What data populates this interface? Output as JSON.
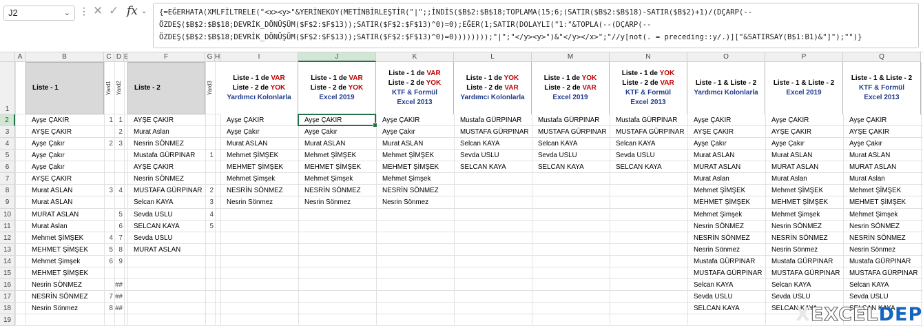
{
  "name_box": {
    "value": "J2",
    "chevron": "⌄"
  },
  "formula_bar": {
    "dots": "⋮",
    "cancel_icon": "✕",
    "enter_icon": "✓",
    "fx_label": "fx",
    "fx_chevron": "⌄",
    "formula": "{=EĞERHATA(XMLFİLTRELE(\"<x><y>\"&YERİNEKOY(METİNBİRLEŞTİR(\"|\";;İNDİS($B$2:$B$18;TOPLAMA(15;6;(SATIR($B$2:$B$18)-SATIR($B$2)+1)/(DÇARP(--ÖZDEŞ($B$2:$B$18;DEVRİK_DÖNÜŞÜM($F$2:$F$13));SATIR($F$2:$F$13)^0)=0);EĞER(1;SATIR(DOLAYLI(\"1:\"&TOPLA(--(DÇARP(--ÖZDEŞ($B$2:$B$18;DEVRİK_DÖNÜŞÜM($F$2:$F$13));SATIR($F$2:$F$13)^0)=0))))))));\"|\";\"</y><y>\")&\"</y></x>\";\"//y[not(. = preceding::y/.)][\"&SATIRSAY(B$1:B1)&\"]\");\"\")}"
  },
  "columns": [
    "A",
    "B",
    "C",
    "D",
    "E",
    "F",
    "G",
    "H",
    "I",
    "J",
    "K",
    "L",
    "M",
    "N",
    "O",
    "P",
    "Q"
  ],
  "rows": [
    "1",
    "2",
    "3",
    "4",
    "5",
    "6",
    "7",
    "8",
    "9",
    "10",
    "11",
    "12",
    "13",
    "14",
    "15",
    "16",
    "17",
    "18",
    "19"
  ],
  "headers": {
    "B": "Liste - 1",
    "C": "Yard1",
    "D": "Yard2",
    "F": "Liste - 2",
    "G": "Yard3",
    "I": [
      "Liste - 1 de ",
      "VAR",
      "Liste - 2 de ",
      "YOK",
      "Yardımcı Kolonlarla"
    ],
    "J": [
      "Liste - 1 de ",
      "VAR",
      "Liste - 2 de ",
      "YOK",
      "Excel 2019"
    ],
    "K": [
      "Liste - 1 de ",
      "VAR",
      "Liste - 2 de ",
      "YOK",
      "KTF & Formül",
      "Excel 2013"
    ],
    "L": [
      "Liste - 1 de ",
      "YOK",
      "Liste - 2 de ",
      "VAR",
      "Yardımcı Kolonlarla"
    ],
    "M": [
      "Liste - 1 de ",
      "YOK",
      "Liste - 2 de ",
      "VAR",
      "Excel 2019"
    ],
    "N": [
      "Liste - 1 de ",
      "YOK",
      "Liste - 2 de ",
      "VAR",
      "KTF & Formül",
      "Excel 2013"
    ],
    "O": [
      "Liste - 1 & Liste - 2",
      "Yardımcı Kolonlarla"
    ],
    "P": [
      "Liste - 1 & Liste - 2",
      "Excel 2019"
    ],
    "Q": [
      "Liste - 1 & Liste - 2",
      "KTF & Formül",
      "Excel 2013"
    ]
  },
  "cells": {
    "B": [
      "Ayşe ÇAKIR",
      "AYŞE ÇAKIR",
      "Ayşe Çakır",
      "Ayşe Çakır",
      "Ayşe Çakır",
      "AYŞE ÇAKIR",
      "Murat ASLAN",
      "Murat ASLAN",
      "MURAT ASLAN",
      "Murat Aslan",
      "Mehmet ŞİMŞEK",
      "MEHMET ŞİMŞEK",
      "Mehmet Şimşek",
      "MEHMET ŞİMŞEK",
      "Nesrin SÖNMEZ",
      "NESRİN SÖNMEZ",
      "Nesrin Sönmez"
    ],
    "C": [
      "1",
      "",
      "2",
      "",
      "",
      "",
      "3",
      "",
      "",
      "",
      "4",
      "5",
      "6",
      "",
      "",
      "7",
      "8"
    ],
    "D": [
      "1",
      "2",
      "3",
      "",
      "",
      "",
      "4",
      "",
      "5",
      "6",
      "7",
      "8",
      "9",
      "",
      "##",
      "##",
      "##"
    ],
    "F": [
      "AYŞE ÇAKIR",
      "Murat Aslan",
      "Nesrin SÖNMEZ",
      "Mustafa GÜRPINAR",
      "AYŞE ÇAKIR",
      "Nesrin SÖNMEZ",
      "MUSTAFA GÜRPINAR",
      "Selcan KAYA",
      "Sevda USLU",
      "SELCAN KAYA",
      "Sevda USLU",
      "MURAT ASLAN"
    ],
    "G": [
      "",
      "",
      "",
      "1",
      "",
      "",
      "2",
      "3",
      "4",
      "5"
    ],
    "I": [
      "Ayşe ÇAKIR",
      "Ayşe Çakır",
      "Murat ASLAN",
      "Mehmet ŞİMŞEK",
      "MEHMET ŞİMŞEK",
      "Mehmet Şimşek",
      "NESRİN SÖNMEZ",
      "Nesrin Sönmez"
    ],
    "J": [
      "Ayşe ÇAKIR",
      "Ayşe Çakır",
      "Murat ASLAN",
      "Mehmet ŞİMŞEK",
      "MEHMET ŞİMŞEK",
      "Mehmet Şimşek",
      "NESRİN SÖNMEZ",
      "Nesrin Sönmez"
    ],
    "K": [
      "Ayşe ÇAKIR",
      "Ayşe Çakır",
      "Murat ASLAN",
      "Mehmet ŞİMŞEK",
      "MEHMET ŞİMŞEK",
      "Mehmet Şimşek",
      "NESRİN SÖNMEZ",
      "Nesrin Sönmez"
    ],
    "L": [
      "Mustafa GÜRPINAR",
      "MUSTAFA GÜRPINAR",
      "Selcan KAYA",
      "Sevda USLU",
      "SELCAN KAYA"
    ],
    "M": [
      "Mustafa GÜRPINAR",
      "MUSTAFA GÜRPINAR",
      "Selcan KAYA",
      "Sevda USLU",
      "SELCAN KAYA"
    ],
    "N": [
      "Mustafa GÜRPINAR",
      "MUSTAFA GÜRPINAR",
      "Selcan KAYA",
      "Sevda USLU",
      "SELCAN KAYA"
    ],
    "O": [
      "Ayşe ÇAKIR",
      "AYŞE ÇAKIR",
      "Ayşe Çakır",
      "Murat ASLAN",
      "MURAT ASLAN",
      "Murat Aslan",
      "Mehmet ŞİMŞEK",
      "MEHMET ŞİMŞEK",
      "Mehmet Şimşek",
      "Nesrin SÖNMEZ",
      "NESRİN SÖNMEZ",
      "Nesrin Sönmez",
      "Mustafa GÜRPINAR",
      "MUSTAFA GÜRPINAR",
      "Selcan KAYA",
      "Sevda USLU",
      "SELCAN KAYA"
    ],
    "P": [
      "Ayşe ÇAKIR",
      "AYŞE ÇAKIR",
      "Ayşe Çakır",
      "Murat ASLAN",
      "MURAT ASLAN",
      "Murat Aslan",
      "Mehmet ŞİMŞEK",
      "MEHMET ŞİMŞEK",
      "Mehmet Şimşek",
      "Nesrin SÖNMEZ",
      "NESRİN SÖNMEZ",
      "Nesrin Sönmez",
      "Mustafa GÜRPINAR",
      "MUSTAFA GÜRPINAR",
      "Selcan KAYA",
      "Sevda USLU",
      "SELCAN KAYA"
    ],
    "Q": [
      "Ayşe ÇAKIR",
      "AYŞE ÇAKIR",
      "Ayşe Çakır",
      "Murat ASLAN",
      "MURAT ASLAN",
      "Murat Aslan",
      "Mehmet ŞİMŞEK",
      "MEHMET ŞİMŞEK",
      "Mehmet Şimşek",
      "Nesrin SÖNMEZ",
      "NESRİN SÖNMEZ",
      "Nesrin Sönmez",
      "Mustafa GÜRPINAR",
      "MUSTAFA GÜRPINAR",
      "Selcan KAYA",
      "Sevda USLU",
      "SELCAN KAYA"
    ]
  },
  "active_cell": {
    "column": "J",
    "row": "2"
  },
  "watermark": {
    "part1": "X",
    "part2": "EXCEL",
    "part3": "DEPO"
  },
  "colors": {
    "accent": "#217346",
    "red": "#c00000",
    "blue": "#1f3b8c",
    "header_fill": "#d9d9d9"
  }
}
